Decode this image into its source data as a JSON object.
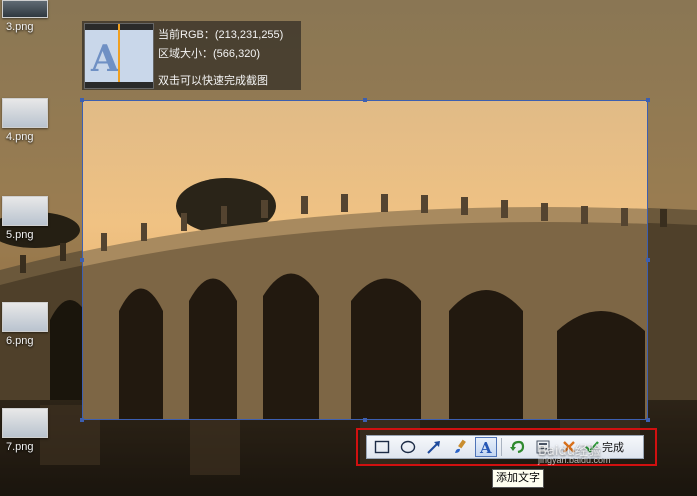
{
  "desktop": {
    "files": [
      {
        "label": "3.png"
      },
      {
        "label": "4.png"
      },
      {
        "label": "5.png"
      },
      {
        "label": "6.png"
      },
      {
        "label": "7.png"
      }
    ]
  },
  "info_panel": {
    "rgb_line": "当前RGB：(213,231,255)",
    "size_line": "区域大小：(566,320)",
    "hint_line": "双击可以快速完成截图"
  },
  "toolbar": {
    "tools": [
      "rectangle-icon",
      "ellipse-icon",
      "arrow-icon",
      "brush-icon",
      "text-icon",
      "undo-icon",
      "save-icon",
      "cancel-icon",
      "finish-icon"
    ],
    "active_tool": "text-icon",
    "accent": "#d01010",
    "selection_color": "#3d5fb0",
    "done_label": "完成",
    "tooltip": "添加文字"
  },
  "watermark": {
    "text": "Baidu经验",
    "sub": "jingyan.baidu.com"
  }
}
